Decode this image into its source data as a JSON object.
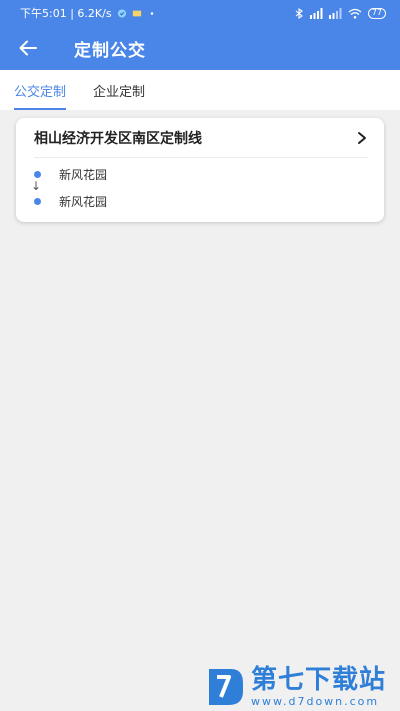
{
  "status_bar": {
    "time_speed": "下午5:01 | 6.2K/s",
    "battery": "77",
    "icons": [
      "verified-icon",
      "message-icon",
      "dot-icon",
      "bluetooth-icon",
      "signal-icon",
      "signal-icon",
      "wifi-icon",
      "battery-icon"
    ]
  },
  "header": {
    "title": "定制公交",
    "back_icon": "arrow-left-icon"
  },
  "tabs": [
    {
      "label": "公交定制",
      "active": true
    },
    {
      "label": "企业定制",
      "active": false
    }
  ],
  "route_card": {
    "name": "相山经济开发区南区定制线",
    "start_stop": "新风花园",
    "arrow": "↓",
    "end_stop": "新风花园"
  },
  "watermark": {
    "brand": "第七下载站",
    "url": "www.d7down.com"
  },
  "colors": {
    "primary": "#4a86e8",
    "background": "#f0f0f0",
    "card": "#ffffff",
    "watermark": "#2f7fd8"
  }
}
